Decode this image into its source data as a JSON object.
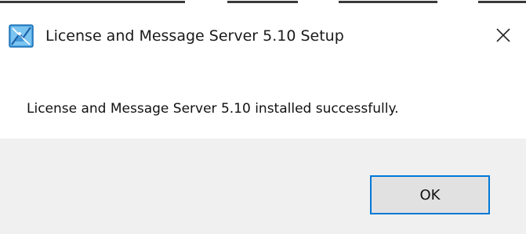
{
  "window": {
    "title": "License and Message Server 5.10 Setup",
    "icon": "setup-app-icon",
    "close_icon": "close-icon"
  },
  "dialog": {
    "message": "License and Message Server 5.10 installed successfully."
  },
  "buttons": {
    "ok_label": "OK"
  },
  "colors": {
    "accent": "#0078d7",
    "footer_bg": "#f0f0f0",
    "button_bg": "#e1e1e1"
  }
}
